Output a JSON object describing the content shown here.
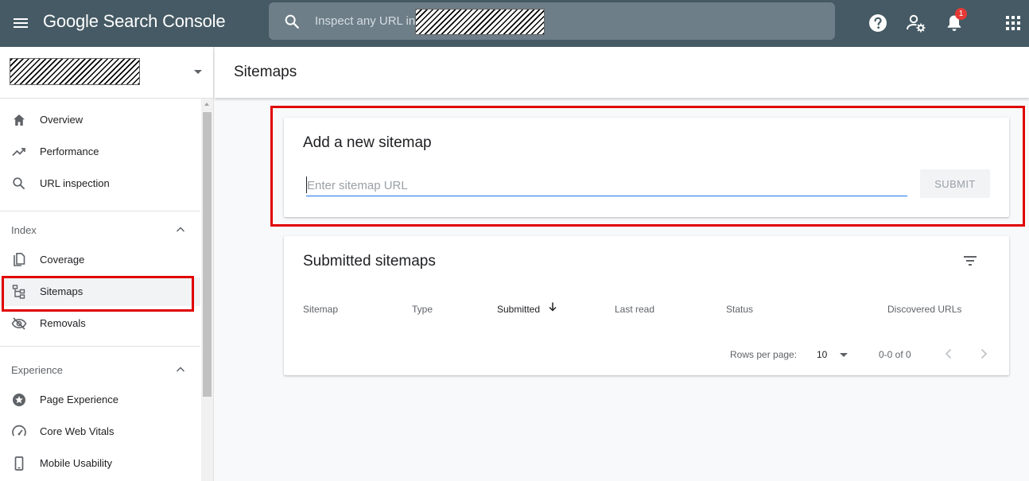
{
  "app": {
    "title": "Google Search Console",
    "search_placeholder": "Inspect any URL in",
    "notification_count": "1"
  },
  "sidebar": {
    "items_top": [
      {
        "label": "Overview",
        "icon": "home-icon"
      },
      {
        "label": "Performance",
        "icon": "trending-up-icon"
      },
      {
        "label": "URL inspection",
        "icon": "search-icon"
      }
    ],
    "index_section": {
      "label": "Index",
      "items": [
        {
          "label": "Coverage",
          "icon": "file-copy-icon"
        },
        {
          "label": "Sitemaps",
          "icon": "sitemap-icon",
          "active": true
        },
        {
          "label": "Removals",
          "icon": "visibility-off-icon"
        }
      ]
    },
    "experience_section": {
      "label": "Experience",
      "items": [
        {
          "label": "Page Experience",
          "icon": "star-badge-icon"
        },
        {
          "label": "Core Web Vitals",
          "icon": "speedometer-icon"
        },
        {
          "label": "Mobile Usability",
          "icon": "phone-icon"
        }
      ]
    }
  },
  "page": {
    "title": "Sitemaps"
  },
  "add_sitemap": {
    "title": "Add a new sitemap",
    "input_placeholder": "Enter sitemap URL",
    "input_value": "",
    "submit_label": "SUBMIT"
  },
  "submitted": {
    "title": "Submitted sitemaps",
    "columns": [
      "Sitemap",
      "Type",
      "Submitted",
      "Last read",
      "Status",
      "Discovered URLs"
    ],
    "sorted_column": "Submitted",
    "rows_per_page_label": "Rows per page:",
    "rows_per_page_value": "10",
    "range_label": "0-0 of 0"
  },
  "colors": {
    "topbar": "#455a64",
    "highlight": "#e00000",
    "input_underline": "#1a73e8",
    "badge": "#e53935"
  }
}
